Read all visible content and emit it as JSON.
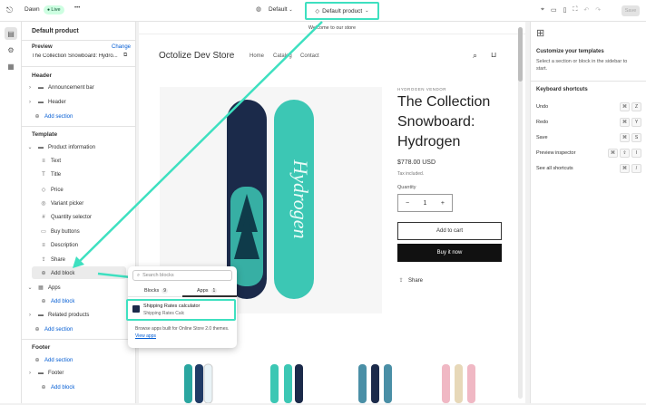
{
  "topbar": {
    "theme_name": "Dawn",
    "live_badge": "Live",
    "more": "•••",
    "store_selector": "Default",
    "template_selector": "Default product",
    "save_label": "Save"
  },
  "left": {
    "title": "Default product",
    "preview_label": "Preview",
    "change_link": "Change",
    "preview_product": "The Collection Snowboard: Hydro...",
    "header_section": "Header",
    "announcement_bar": "Announcement bar",
    "header_item": "Header",
    "add_section": "Add section",
    "template_section": "Template",
    "product_information": "Product information",
    "blocks": [
      "Text",
      "Title",
      "Price",
      "Variant picker",
      "Quantity selector",
      "Buy buttons",
      "Description",
      "Share"
    ],
    "add_block": "Add block",
    "apps": "Apps",
    "related_products": "Related products",
    "footer_section": "Footer",
    "footer_item": "Footer"
  },
  "popover": {
    "search_placeholder": "Search blocks",
    "tab_blocks": "Blocks",
    "tab_blocks_count": "9",
    "tab_apps": "Apps",
    "tab_apps_count": "1",
    "app_name": "Shipping Rates calculator",
    "app_vendor": "Shipping Rates Calc",
    "browse_text": "Browse apps built for Online Store 2.0 themes.",
    "view_apps": "View apps"
  },
  "store": {
    "announcement": "Welcome to our store",
    "name": "Octolize Dev Store",
    "nav": [
      "Home",
      "Catalog",
      "Contact"
    ],
    "vendor": "HYDROGEN VENDOR",
    "product_title": "The Collection Snowboard: Hydrogen",
    "price": "$778.00 USD",
    "tax_note": "Tax included.",
    "quantity_label": "Quantity",
    "quantity_value": "1",
    "minus": "−",
    "plus": "+",
    "add_to_cart": "Add to cart",
    "buy_now": "Buy it now",
    "share": "Share",
    "board_text": "Hydrogen"
  },
  "right": {
    "customize_title": "Customize your templates",
    "customize_desc": "Select a section or block in the sidebar to start.",
    "shortcuts_title": "Keyboard shortcuts",
    "shortcuts": [
      {
        "label": "Undo",
        "keys": [
          "⌘",
          "Z"
        ]
      },
      {
        "label": "Redo",
        "keys": [
          "⌘",
          "Y"
        ]
      },
      {
        "label": "Save",
        "keys": [
          "⌘",
          "S"
        ]
      },
      {
        "label": "Preview inspector",
        "keys": [
          "⌘",
          "⇧",
          "I"
        ]
      },
      {
        "label": "See all shortcuts",
        "keys": [
          "⌘",
          "/"
        ]
      }
    ]
  },
  "colors": {
    "highlight": "#3ee0c0",
    "live_green": "#cdfee1",
    "link_blue": "#005bd3",
    "board_teal": "#3cc7b4",
    "board_navy": "#1b2a4a"
  }
}
